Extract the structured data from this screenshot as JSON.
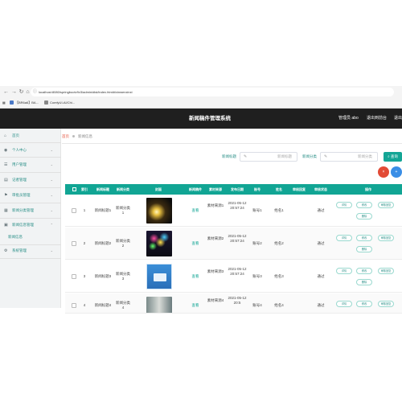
{
  "browser": {
    "url": "localhost:8080/springbootv9v3/admin/dist/index.html#/xinwenxinxi",
    "bookmarks": [
      "【BR6a6】BA...",
      "ComfyUI-AI/Chi..."
    ]
  },
  "header": {
    "title": "新闻稿件管理系统",
    "user_label": "管理员 abo",
    "exit_admin": "退出到前台",
    "logout": "退出"
  },
  "sidebar": {
    "items": [
      {
        "icon": "home-icon",
        "label": "首页"
      },
      {
        "icon": "user-icon",
        "label": "个人中心"
      },
      {
        "icon": "users-icon",
        "label": "用户管理"
      },
      {
        "icon": "document-icon",
        "label": "记者管理"
      },
      {
        "icon": "reviewer-icon",
        "label": "审批员管理"
      },
      {
        "icon": "category-icon",
        "label": "新闻分类管理"
      },
      {
        "icon": "news-icon",
        "label": "新闻信息管理"
      },
      {
        "icon": "settings-icon",
        "label": "系统管理"
      }
    ],
    "sub_item": "新闻信息"
  },
  "breadcrumb": {
    "home": "首页",
    "current": "新闻信息"
  },
  "search": {
    "title_label": "新闻标题",
    "title_placeholder": "新闻标题",
    "category_label": "新闻分类",
    "category_placeholder": "新闻分类",
    "button": "查询"
  },
  "action_buttons": {
    "delete": "×",
    "add": "+"
  },
  "table": {
    "headers": [
      "",
      "索引",
      "新闻标题",
      "新闻分类",
      "封面",
      "新闻稿件",
      "素材来源",
      "发布日期",
      "账号",
      "姓名",
      "审核回复",
      "审核状态",
      "操作"
    ],
    "rows": [
      {
        "index": "1",
        "title": "新闻标题1",
        "category": "新闻分类1",
        "file_link": "查看",
        "source": "素材来源1",
        "date": "2021-05-12 20:57:24",
        "account": "账号1",
        "name": "姓名1",
        "reply": "",
        "status": "通过"
      },
      {
        "index": "2",
        "title": "新闻标题2",
        "category": "新闻分类2",
        "file_link": "查看",
        "source": "素材来源2",
        "date": "2021-05-12 20:57:24",
        "account": "账号2",
        "name": "姓名2",
        "reply": "",
        "status": "通过"
      },
      {
        "index": "3",
        "title": "新闻标题3",
        "category": "新闻分类3",
        "file_link": "查看",
        "source": "素材来源3",
        "date": "2021-05-12 20:57:24",
        "account": "账号3",
        "name": "姓名3",
        "reply": "",
        "status": "通过"
      },
      {
        "index": "4",
        "title": "新闻标题4",
        "category": "新闻分类4",
        "file_link": "查看",
        "source": "素材来源4",
        "date": "2021-05-12 20:5",
        "account": "账号4",
        "name": "姓名4",
        "reply": "",
        "status": "通过"
      }
    ],
    "ops": {
      "detail": "详情",
      "edit": "修改",
      "review": "审核回复",
      "delete": "删除"
    }
  },
  "colors": {
    "accent": "#11a594",
    "header_bg": "#1f1f1f",
    "danger": "#e24b36",
    "primary": "#3a8ee6"
  }
}
